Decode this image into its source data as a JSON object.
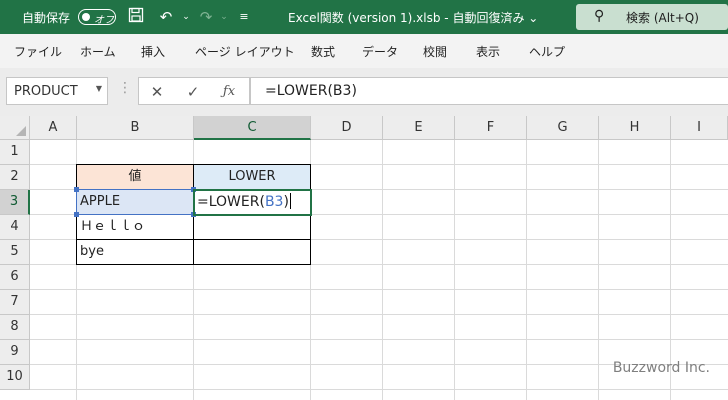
{
  "titlebar": {
    "autosave_label": "自動保存",
    "autosave_state": "オフ",
    "filename": "Excel関数 (version 1).xlsb  -  自動回復済み  ⌄",
    "search_label": "検索 (Alt+Q)",
    "icons": [
      "save-icon",
      "undo-icon",
      "redo-icon",
      "customize-icon",
      "search-icon"
    ]
  },
  "ribbon": {
    "tabs": [
      "ファイル",
      "ホーム",
      "挿入",
      "ページ レイアウト",
      "数式",
      "データ",
      "校閲",
      "表示",
      "ヘルプ"
    ]
  },
  "formula_bar": {
    "name_box": "PRODUCT",
    "formula": "=LOWER(B3)"
  },
  "sheet": {
    "columns": [
      "A",
      "B",
      "C",
      "D",
      "E",
      "F",
      "G",
      "H",
      "I"
    ],
    "rows": [
      "1",
      "2",
      "3",
      "4",
      "5",
      "6",
      "7",
      "8",
      "9",
      "10"
    ],
    "selected_column": "C",
    "selected_row": "3",
    "header_b2": "値",
    "header_c2": "LOWER",
    "b3": "APPLE",
    "b4": "Ｈｅｌｌｏ",
    "b5": "bye",
    "c3_prefix": "=LOWER(",
    "c3_ref": "B3",
    "c3_suffix": ")",
    "colors": {
      "header_b_fill": "#fce4d6",
      "header_c_fill": "#ddebf7",
      "ref_highlight": "#4472c4",
      "accent": "#217346"
    }
  },
  "watermark": "Buzzword Inc."
}
